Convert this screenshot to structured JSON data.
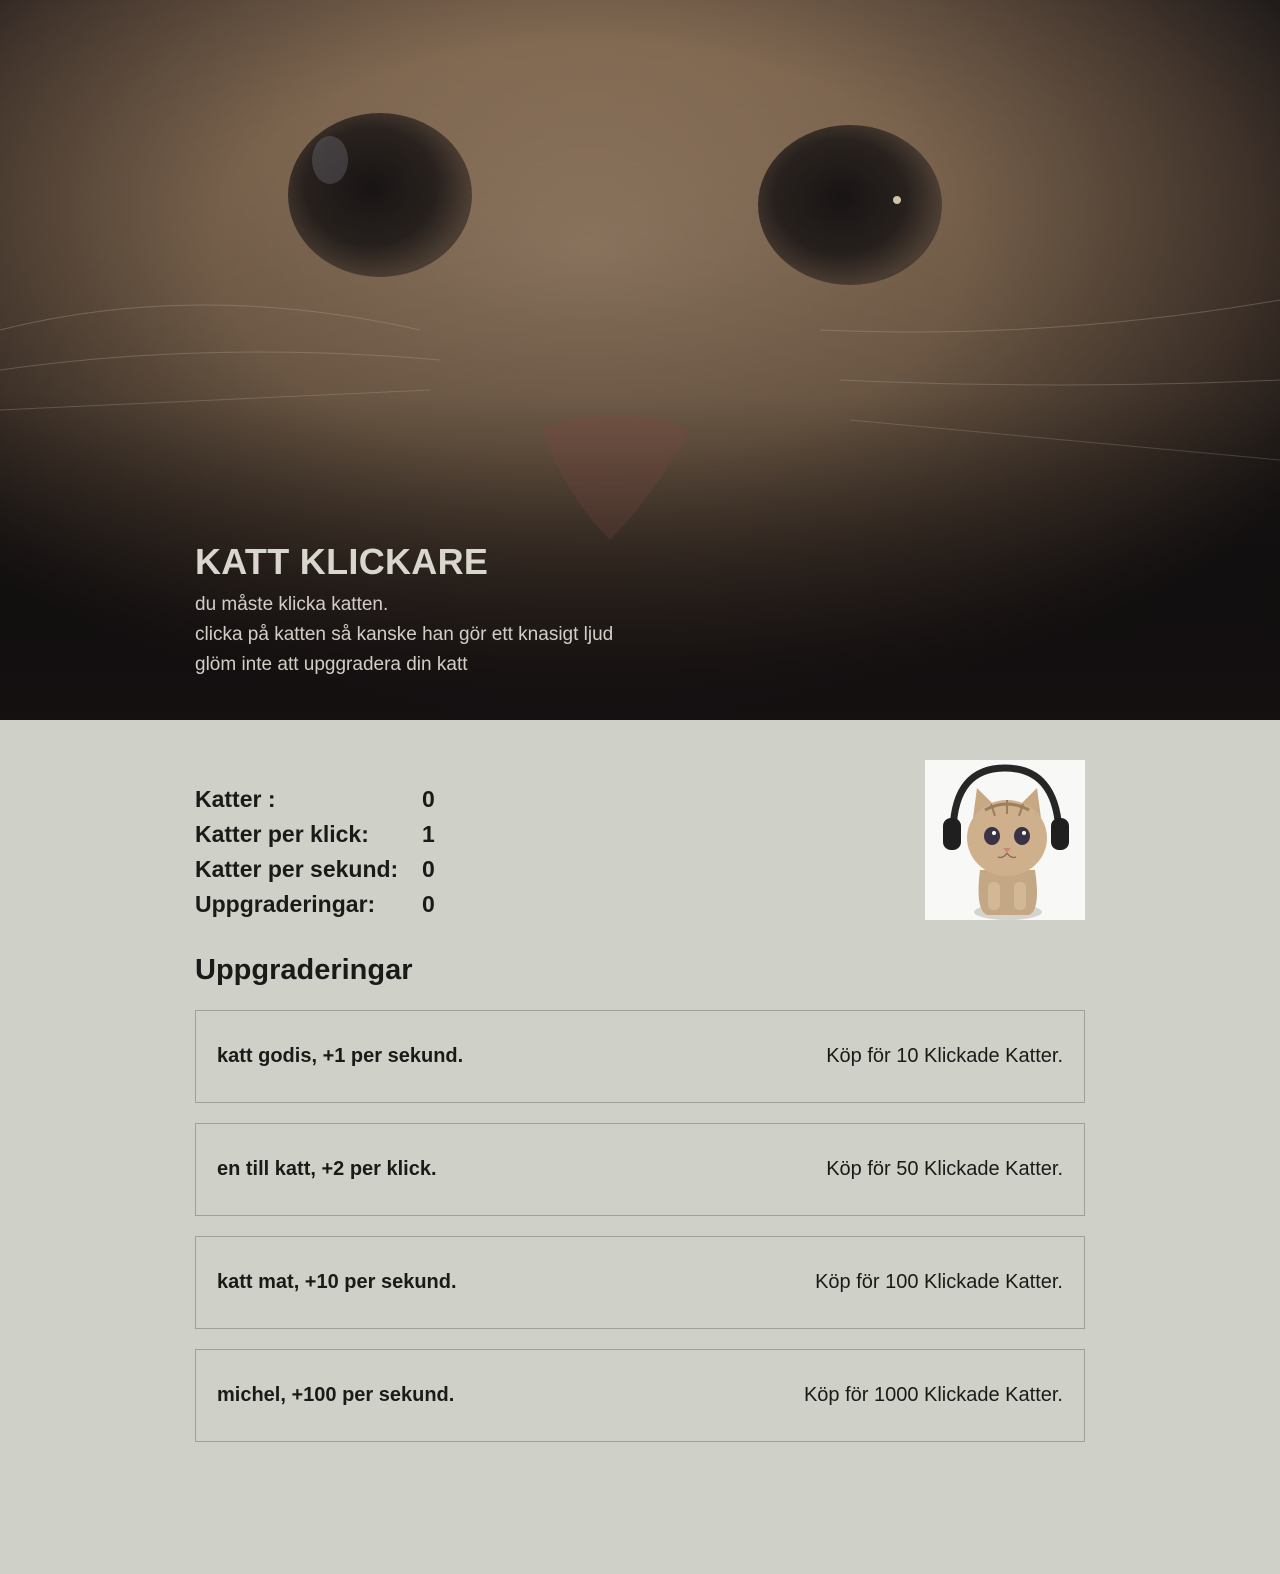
{
  "hero": {
    "title": "KATT KLICKARE",
    "lines": [
      "du måste klicka katten.",
      "clicka på katten så kanske han gör ett knasigt ljud",
      "glöm inte att upggradera din katt"
    ]
  },
  "stats": [
    {
      "label": "Katter :",
      "value": "0"
    },
    {
      "label": "Katter per klick:",
      "value": "1"
    },
    {
      "label": "Katter per sekund:",
      "value": "0"
    },
    {
      "label": "Uppgraderingar:",
      "value": "0"
    }
  ],
  "upgrades_heading": "Uppgraderingar",
  "upgrades": [
    {
      "name": "katt godis, +1 per sekund.",
      "price": "Köp för 10 Klickade Katter."
    },
    {
      "name": "en till katt, +2 per klick.",
      "price": "Köp för 50 Klickade Katter."
    },
    {
      "name": "katt mat, +10 per sekund.",
      "price": "Köp för 100 Klickade Katter."
    },
    {
      "name": "michel, +100 per sekund.",
      "price": "Köp för 1000 Klickade Katter."
    }
  ],
  "colors": {
    "page_background": "#cfd1c9",
    "text": "#1b1a18",
    "hero_text": "#d9d6ce",
    "upgrade_border": "#9ea09a"
  }
}
